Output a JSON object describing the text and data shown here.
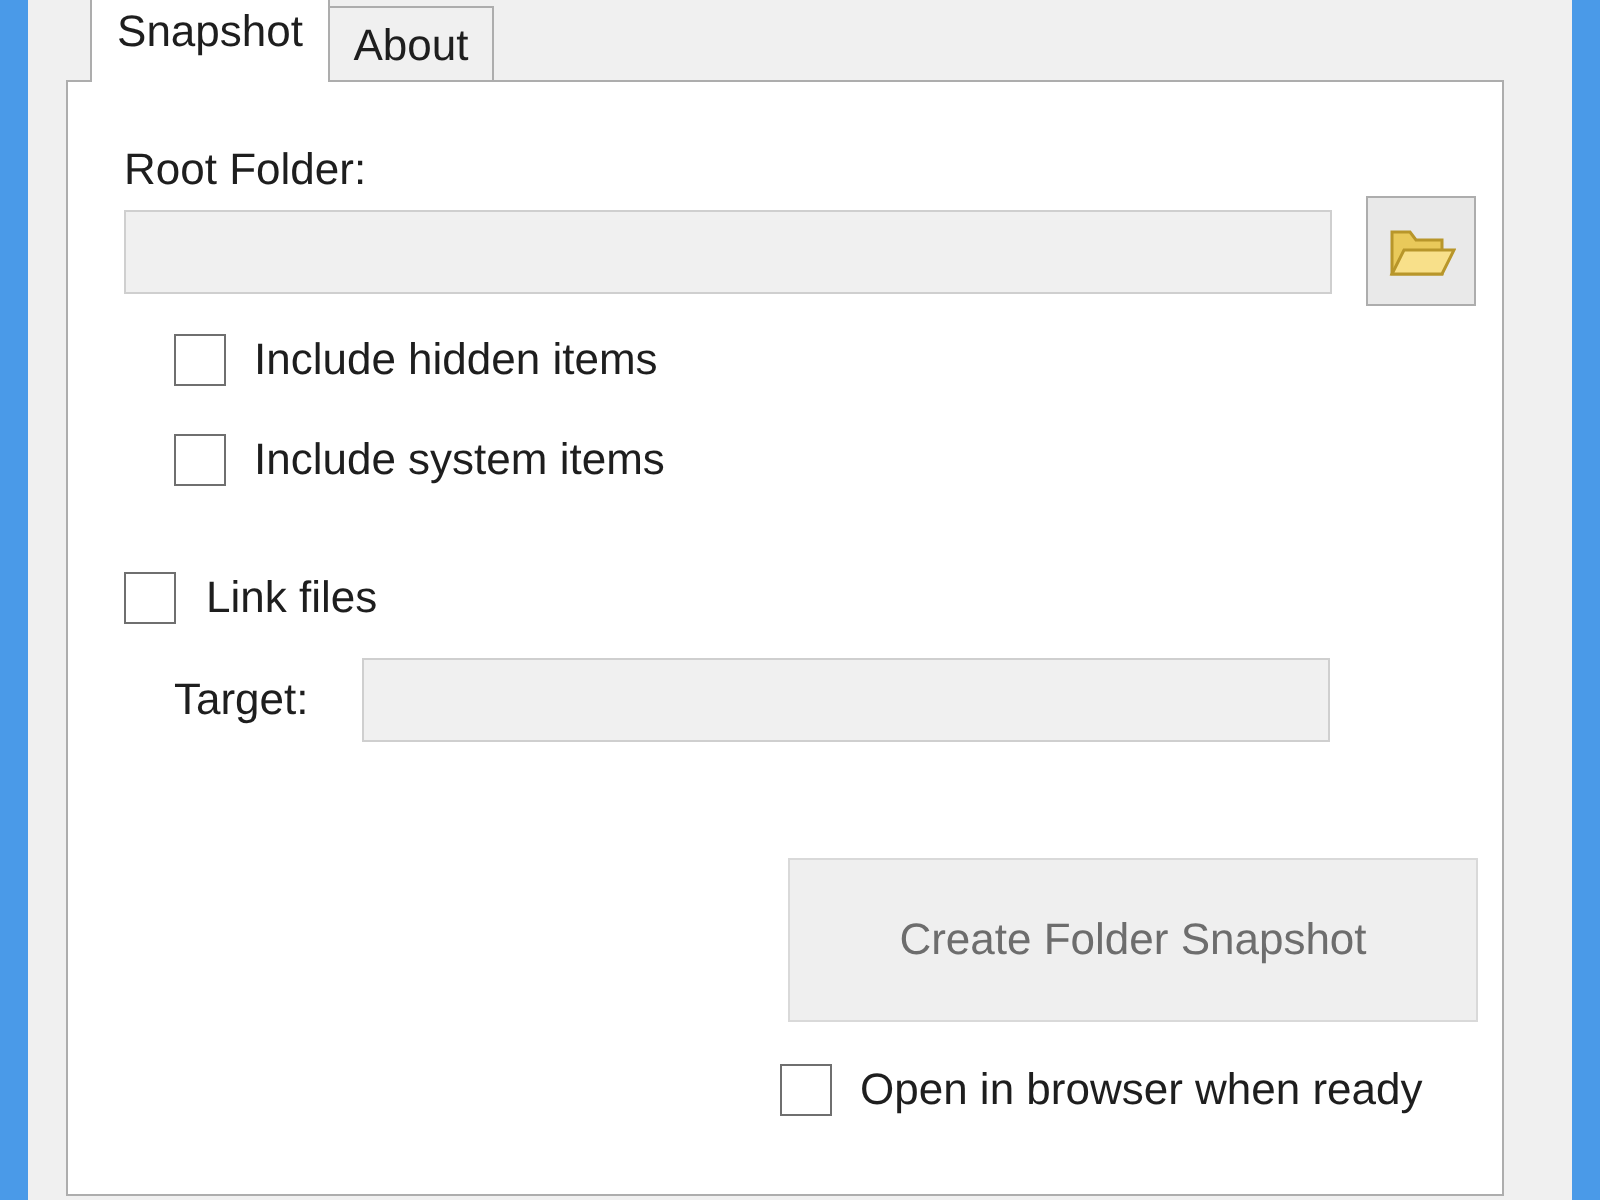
{
  "tabs": [
    {
      "label": "Snapshot",
      "selected": true
    },
    {
      "label": "About",
      "selected": false
    }
  ],
  "root_folder": {
    "label": "Root Folder:",
    "field": {
      "disabled": true
    }
  },
  "options": [
    {
      "label": "Include hidden items",
      "checked": false
    },
    {
      "label": "Include system items",
      "checked": false
    }
  ],
  "link_files": {
    "label": "Link files",
    "checked": false
  },
  "target": {
    "label": "Target:",
    "field": {
      "disabled": true
    }
  },
  "create_button": {
    "label": "Create Folder Snapshot",
    "disabled": true
  },
  "open_in_browser": {
    "label": "Open in browser when ready",
    "checked": false
  }
}
